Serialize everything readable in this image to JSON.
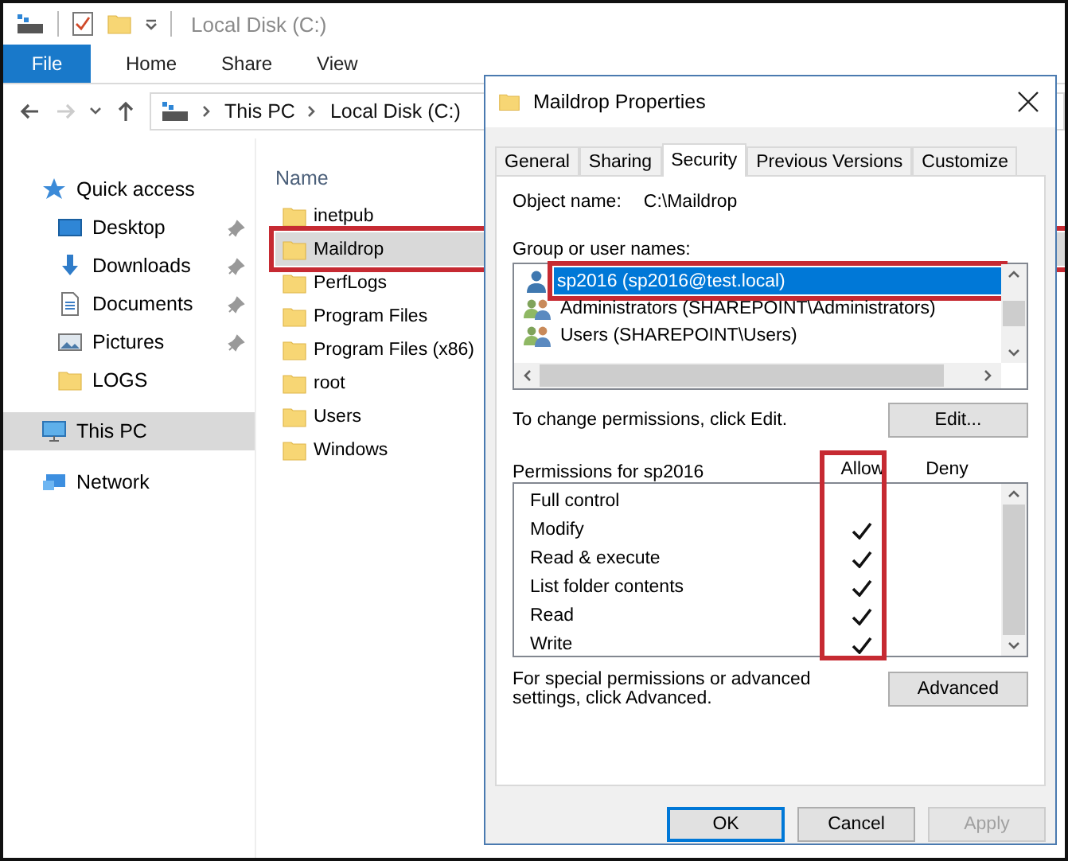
{
  "explorer": {
    "title": "Local Disk (C:)",
    "ribbon_tabs": [
      {
        "label": "File",
        "kind": "file"
      },
      {
        "label": "Home",
        "kind": "tab"
      },
      {
        "label": "Share",
        "kind": "tab"
      },
      {
        "label": "View",
        "kind": "tab"
      }
    ],
    "address": [
      "This PC",
      "Local Disk (C:)"
    ],
    "nav": [
      {
        "label": "Quick access",
        "kind": "star",
        "selected": false,
        "pinned": false,
        "children": [
          {
            "label": "Desktop",
            "kind": "desktop",
            "selected": false,
            "pinned": true
          },
          {
            "label": "Downloads",
            "kind": "download",
            "selected": false,
            "pinned": true
          },
          {
            "label": "Documents",
            "kind": "document",
            "selected": false,
            "pinned": true
          },
          {
            "label": "Pictures",
            "kind": "picture",
            "selected": false,
            "pinned": true
          },
          {
            "label": "LOGS",
            "kind": "folder",
            "selected": false,
            "pinned": false
          }
        ]
      },
      {
        "label": "This PC",
        "kind": "pc",
        "selected": true,
        "pinned": false
      },
      {
        "label": "Network",
        "kind": "network",
        "selected": false,
        "pinned": false
      }
    ],
    "column": "Name",
    "files": [
      {
        "name": "inetpub",
        "selected": false,
        "highlighted": false
      },
      {
        "name": "Maildrop",
        "selected": true,
        "highlighted": true
      },
      {
        "name": "PerfLogs",
        "selected": false,
        "highlighted": false
      },
      {
        "name": "Program Files",
        "selected": false,
        "highlighted": false
      },
      {
        "name": "Program Files (x86)",
        "selected": false,
        "highlighted": false
      },
      {
        "name": "root",
        "selected": false,
        "highlighted": false
      },
      {
        "name": "Users",
        "selected": false,
        "highlighted": false
      },
      {
        "name": "Windows",
        "selected": false,
        "highlighted": false
      }
    ]
  },
  "dialog": {
    "title": "Maildrop Properties",
    "tabs": [
      {
        "label": "General",
        "selected": false
      },
      {
        "label": "Sharing",
        "selected": false
      },
      {
        "label": "Security",
        "selected": true
      },
      {
        "label": "Previous Versions",
        "selected": false
      },
      {
        "label": "Customize",
        "selected": false
      }
    ],
    "object_label": "Object name:",
    "object_value": "C:\\Maildrop",
    "group_label": "Group or user names:",
    "users": [
      {
        "name": "sp2016 (sp2016@test.local)",
        "kind": "user",
        "selected": true,
        "highlighted": true
      },
      {
        "name": "Administrators (SHAREPOINT\\Administrators)",
        "kind": "group",
        "selected": false,
        "highlighted": false
      },
      {
        "name": "Users (SHAREPOINT\\Users)",
        "kind": "group",
        "selected": false,
        "highlighted": false
      }
    ],
    "change_hint": "To change permissions, click Edit.",
    "edit_button": "Edit...",
    "permissions": {
      "title": "Permissions for sp2016",
      "allow_label": "Allow",
      "deny_label": "Deny",
      "allow_highlighted": true,
      "rows": [
        {
          "name": "Full control",
          "allow": false,
          "deny": false
        },
        {
          "name": "Modify",
          "allow": true,
          "deny": false
        },
        {
          "name": "Read & execute",
          "allow": true,
          "deny": false
        },
        {
          "name": "List folder contents",
          "allow": true,
          "deny": false
        },
        {
          "name": "Read",
          "allow": true,
          "deny": false
        },
        {
          "name": "Write",
          "allow": true,
          "deny": false
        }
      ]
    },
    "advanced_hint": "For special permissions or advanced settings, click Advanced.",
    "advanced_button": "Advanced",
    "buttons": [
      {
        "label": "OK",
        "kind": "default"
      },
      {
        "label": "Cancel",
        "kind": "normal"
      },
      {
        "label": "Apply",
        "kind": "disabled"
      }
    ]
  }
}
